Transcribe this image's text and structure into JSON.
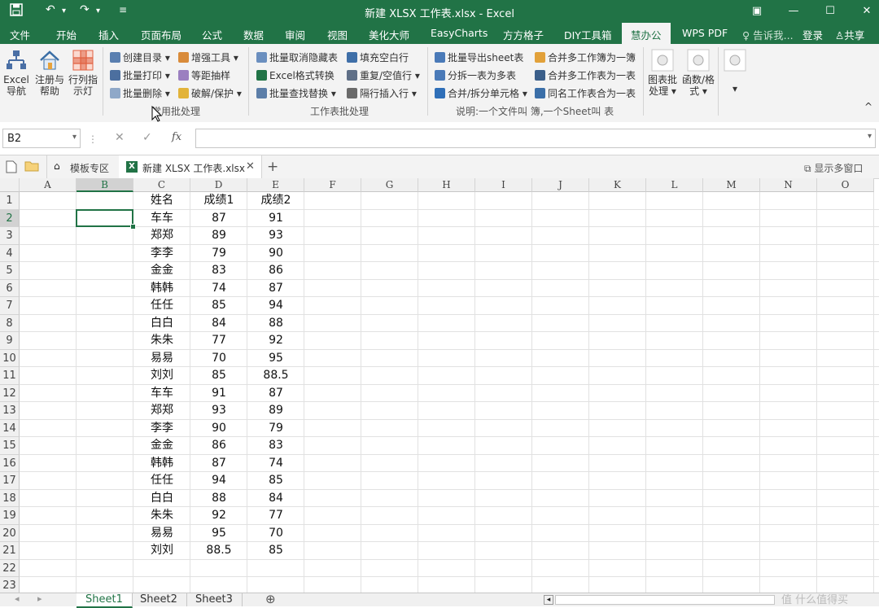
{
  "window": {
    "title": "新建 XLSX 工作表.xlsx - Excel"
  },
  "ribbon_tabs": [
    "文件",
    "开始",
    "插入",
    "页面布局",
    "公式",
    "数据",
    "审阅",
    "视图",
    "美化大师",
    "EasyCharts",
    "方方格子",
    "DIY工具箱",
    "慧办公",
    "WPS PDF"
  ],
  "active_tab": "慧办公",
  "tell_me": "告诉我...",
  "login": "登录",
  "share": "共享",
  "ribbon": {
    "excel_nav": "Excel\n导航",
    "register_help": "注册与\n帮助",
    "row_col_light": "行列指\n示灯",
    "create_toc": "创建目录",
    "batch_print": "批量打印",
    "batch_delete": "批量删除",
    "enhance_tools": "增强工具",
    "equal_sampling": "等距抽样",
    "crack_protect": "破解/保护",
    "group1_label": "常用批处理",
    "batch_unhide": "批量取消隐藏表",
    "excel_convert": "Excel格式转换",
    "batch_find_replace": "批量查找替换",
    "fill_blank_row": "填充空白行",
    "repeat_blank_row": "重复/空值行",
    "interval_insert_row": "隔行插入行",
    "group2_label": "工作表批处理",
    "batch_export_sheet": "批量导出sheet表",
    "split_table": "分拆一表为多表",
    "merge_split_cells": "合并/拆分单元格",
    "merge_workbooks": "合并多工作簿为一簿",
    "merge_sheets": "合并多工作表为一表",
    "merge_same_name": "同名工作表合为一表",
    "group3_label": "说明:一个文件叫 簿,一个Sheet叫 表",
    "chart_batch": "图表批\n处理",
    "func_format": "函数/格\n式"
  },
  "formula_bar": {
    "name_box": "B2",
    "fx": "fx",
    "value": ""
  },
  "doc_tabs": {
    "template": "模板专区",
    "file": "新建 XLSX 工作表.xlsx",
    "multi_window": "显示多窗口"
  },
  "columns": [
    "A",
    "B",
    "C",
    "D",
    "E",
    "F",
    "G",
    "H",
    "I",
    "J",
    "K",
    "L",
    "M",
    "N",
    "O"
  ],
  "row_numbers": [
    "1",
    "2",
    "3",
    "4",
    "5",
    "6",
    "7",
    "8",
    "9",
    "10",
    "11",
    "12",
    "13",
    "14",
    "15",
    "16",
    "17",
    "18",
    "19",
    "20",
    "21",
    "22",
    "23"
  ],
  "headers": [
    "姓名",
    "成绩1",
    "成绩2"
  ],
  "rows": [
    [
      "车车",
      "87",
      "91"
    ],
    [
      "郑郑",
      "89",
      "93"
    ],
    [
      "李李",
      "79",
      "90"
    ],
    [
      "金金",
      "83",
      "86"
    ],
    [
      "韩韩",
      "74",
      "87"
    ],
    [
      "任任",
      "85",
      "94"
    ],
    [
      "白白",
      "84",
      "88"
    ],
    [
      "朱朱",
      "77",
      "92"
    ],
    [
      "易易",
      "70",
      "95"
    ],
    [
      "刘刘",
      "85",
      "88.5"
    ],
    [
      "车车",
      "91",
      "87"
    ],
    [
      "郑郑",
      "93",
      "89"
    ],
    [
      "李李",
      "90",
      "79"
    ],
    [
      "金金",
      "86",
      "83"
    ],
    [
      "韩韩",
      "87",
      "74"
    ],
    [
      "任任",
      "94",
      "85"
    ],
    [
      "白白",
      "88",
      "84"
    ],
    [
      "朱朱",
      "92",
      "77"
    ],
    [
      "易易",
      "95",
      "70"
    ],
    [
      "刘刘",
      "88.5",
      "85"
    ]
  ],
  "sheet_tabs": [
    "Sheet1",
    "Sheet2",
    "Sheet3"
  ],
  "active_sheet": "Sheet1",
  "watermark": "值 什么值得买",
  "colors": {
    "accent": "#217346"
  }
}
